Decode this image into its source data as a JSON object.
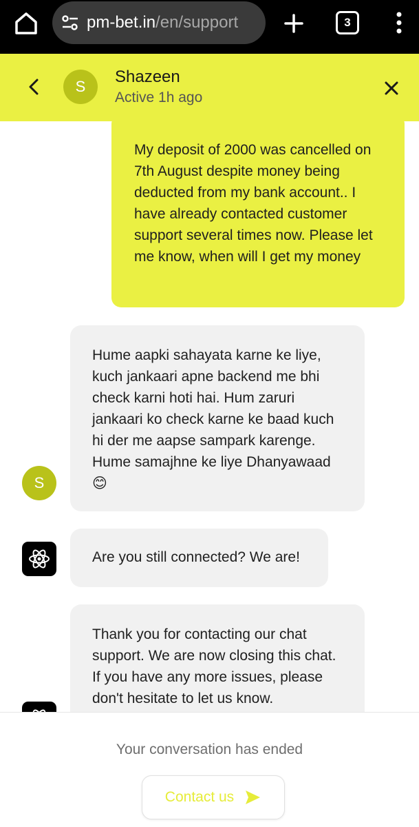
{
  "browser": {
    "url_host": "pm-bet.in",
    "url_path": "/en/support",
    "tab_count": "3"
  },
  "header": {
    "avatar_initial": "S",
    "agent_name": "Shazeen",
    "status": "Active 1h ago"
  },
  "messages": [
    {
      "sender": "user",
      "text": "My deposit of 2000 was cancelled on 7th August despite money being deducted from my bank account.. I have already contacted customer support several times now. Please let me know, when will I get my money"
    },
    {
      "sender": "agent",
      "avatar_initial": "S",
      "text": "Hume aapki sahayata karne ke liye, kuch jankaari apne backend me bhi check karni hoti hai. Hum zaruri jankaari ko check karne ke baad kuch hi der me aapse sampark karenge. Hume samajhne ke liye Dhanyawaad 😊"
    },
    {
      "sender": "bot",
      "text": "Are you still connected? We are!"
    },
    {
      "sender": "bot",
      "text": "Thank you for contacting our chat support. We are now closing this chat. If you have any more issues, please don't hesitate to let us know."
    }
  ],
  "footer": {
    "ended_text": "Your conversation has ended",
    "contact_label": "Contact us"
  },
  "colors": {
    "accent": "#eaf043",
    "avatar": "#b9c21a",
    "agent_bubble": "#f1f1f1",
    "contact_text": "#e6ec3a"
  }
}
